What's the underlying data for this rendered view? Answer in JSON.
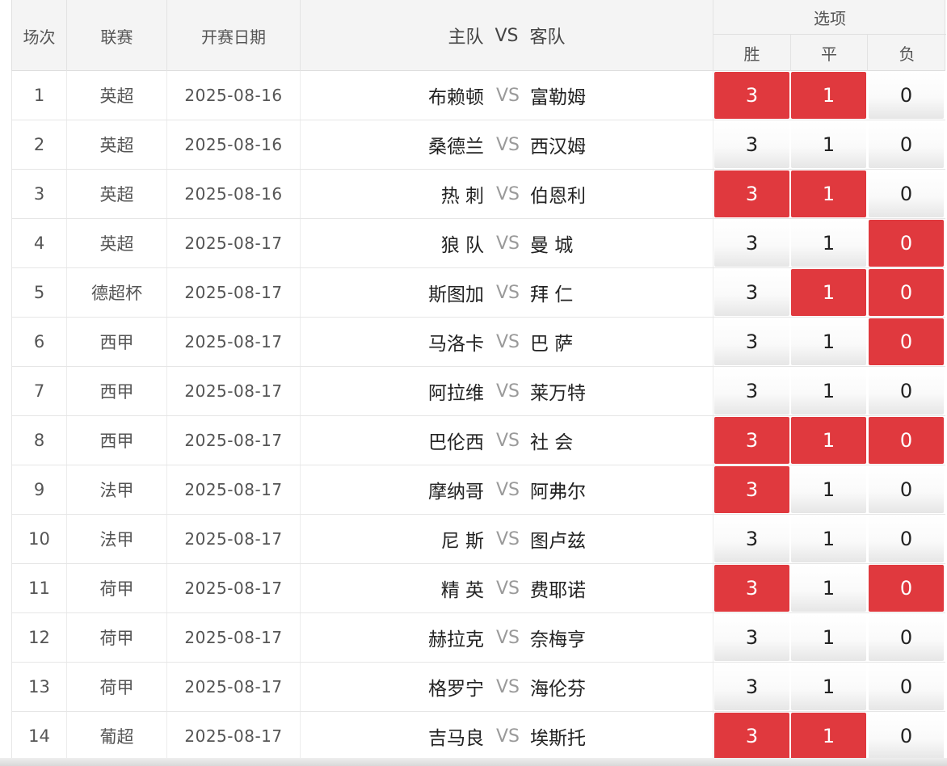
{
  "header": {
    "round": "场次",
    "league": "联赛",
    "date": "开赛日期",
    "home": "主队",
    "vs": "VS",
    "away": "客队",
    "options": "选项",
    "win": "胜",
    "draw": "平",
    "loss": "负"
  },
  "colors": {
    "selected": "#e0393e",
    "vs_text": "#9a9a9a",
    "header_bg": "#f4f4f4"
  },
  "rows": [
    {
      "no": "1",
      "league": "英超",
      "date": "2025-08-16",
      "home": "布赖顿",
      "away": "富勒姆",
      "win": "3",
      "draw": "1",
      "loss": "0",
      "win_selected": true,
      "draw_selected": true,
      "loss_selected": false
    },
    {
      "no": "2",
      "league": "英超",
      "date": "2025-08-16",
      "home": "桑德兰",
      "away": "西汉姆",
      "win": "3",
      "draw": "1",
      "loss": "0",
      "win_selected": false,
      "draw_selected": false,
      "loss_selected": false
    },
    {
      "no": "3",
      "league": "英超",
      "date": "2025-08-16",
      "home": "热 刺",
      "away": "伯恩利",
      "win": "3",
      "draw": "1",
      "loss": "0",
      "win_selected": true,
      "draw_selected": true,
      "loss_selected": false
    },
    {
      "no": "4",
      "league": "英超",
      "date": "2025-08-17",
      "home": "狼 队",
      "away": "曼 城",
      "win": "3",
      "draw": "1",
      "loss": "0",
      "win_selected": false,
      "draw_selected": false,
      "loss_selected": true
    },
    {
      "no": "5",
      "league": "德超杯",
      "date": "2025-08-17",
      "home": "斯图加",
      "away": "拜 仁",
      "win": "3",
      "draw": "1",
      "loss": "0",
      "win_selected": false,
      "draw_selected": true,
      "loss_selected": true
    },
    {
      "no": "6",
      "league": "西甲",
      "date": "2025-08-17",
      "home": "马洛卡",
      "away": "巴 萨",
      "win": "3",
      "draw": "1",
      "loss": "0",
      "win_selected": false,
      "draw_selected": false,
      "loss_selected": true
    },
    {
      "no": "7",
      "league": "西甲",
      "date": "2025-08-17",
      "home": "阿拉维",
      "away": "莱万特",
      "win": "3",
      "draw": "1",
      "loss": "0",
      "win_selected": false,
      "draw_selected": false,
      "loss_selected": false
    },
    {
      "no": "8",
      "league": "西甲",
      "date": "2025-08-17",
      "home": "巴伦西",
      "away": "社 会",
      "win": "3",
      "draw": "1",
      "loss": "0",
      "win_selected": true,
      "draw_selected": true,
      "loss_selected": true
    },
    {
      "no": "9",
      "league": "法甲",
      "date": "2025-08-17",
      "home": "摩纳哥",
      "away": "阿弗尔",
      "win": "3",
      "draw": "1",
      "loss": "0",
      "win_selected": true,
      "draw_selected": false,
      "loss_selected": false
    },
    {
      "no": "10",
      "league": "法甲",
      "date": "2025-08-17",
      "home": "尼 斯",
      "away": "图卢兹",
      "win": "3",
      "draw": "1",
      "loss": "0",
      "win_selected": false,
      "draw_selected": false,
      "loss_selected": false
    },
    {
      "no": "11",
      "league": "荷甲",
      "date": "2025-08-17",
      "home": "精 英",
      "away": "费耶诺",
      "win": "3",
      "draw": "1",
      "loss": "0",
      "win_selected": true,
      "draw_selected": false,
      "loss_selected": true
    },
    {
      "no": "12",
      "league": "荷甲",
      "date": "2025-08-17",
      "home": "赫拉克",
      "away": "奈梅亨",
      "win": "3",
      "draw": "1",
      "loss": "0",
      "win_selected": false,
      "draw_selected": false,
      "loss_selected": false
    },
    {
      "no": "13",
      "league": "荷甲",
      "date": "2025-08-17",
      "home": "格罗宁",
      "away": "海伦芬",
      "win": "3",
      "draw": "1",
      "loss": "0",
      "win_selected": false,
      "draw_selected": false,
      "loss_selected": false
    },
    {
      "no": "14",
      "league": "葡超",
      "date": "2025-08-17",
      "home": "吉马良",
      "away": "埃斯托",
      "win": "3",
      "draw": "1",
      "loss": "0",
      "win_selected": true,
      "draw_selected": true,
      "loss_selected": false
    }
  ]
}
